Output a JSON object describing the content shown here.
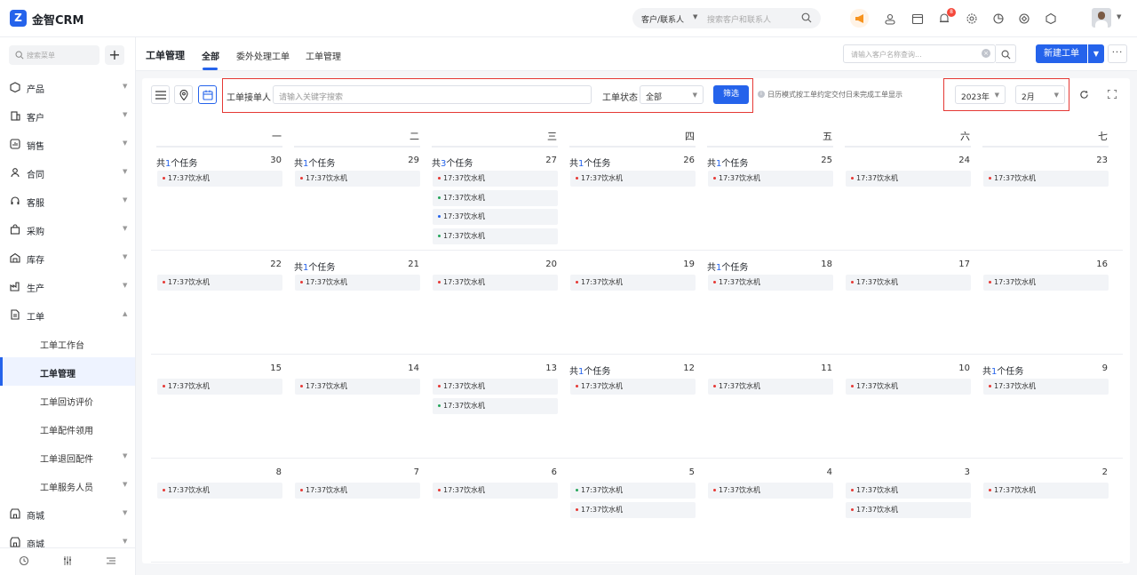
{
  "app": {
    "logo_letter": "Z",
    "brand": "金智CRM"
  },
  "topbar": {
    "search_type": "客户/联系人",
    "search_placeholder": "搜索客户和联系人",
    "notification_count": "8"
  },
  "sidebar": {
    "search_placeholder": "搜索菜单",
    "add_label": "+",
    "items": [
      {
        "label": "产品",
        "icon": "cube-icon"
      },
      {
        "label": "客户",
        "icon": "building-icon"
      },
      {
        "label": "销售",
        "icon": "chart-icon"
      },
      {
        "label": "合同",
        "icon": "person-icon"
      },
      {
        "label": "客服",
        "icon": "headset-icon"
      },
      {
        "label": "采购",
        "icon": "bag-icon"
      },
      {
        "label": "库存",
        "icon": "warehouse-icon"
      },
      {
        "label": "生产",
        "icon": "factory-icon"
      },
      {
        "label": "工单",
        "icon": "document-icon"
      }
    ],
    "sub_items": [
      {
        "label": "工单工作台"
      },
      {
        "label": "工单管理"
      },
      {
        "label": "工单回访评价"
      },
      {
        "label": "工单配件领用"
      },
      {
        "label": "工单退回配件"
      },
      {
        "label": "工单服务人员"
      }
    ],
    "bottom_items": [
      {
        "label": "商城",
        "icon": "store-icon"
      },
      {
        "label": "商城",
        "icon": "store-icon"
      }
    ]
  },
  "tabs": {
    "page_title": "工单管理",
    "items": [
      {
        "label": "全部"
      },
      {
        "label": "委外处理工单"
      },
      {
        "label": "工单管理"
      }
    ],
    "customer_search_placeholder": "请输入客户名称查询...",
    "new_button": "新建工单",
    "more_label": "···"
  },
  "filters": {
    "assignee_label": "工单接单人",
    "keyword_placeholder": "请输入关键字搜索",
    "status_label": "工单状态",
    "status_value": "全部",
    "filter_button": "筛选",
    "hint": "日历模式按工单约定交付日未完成工单显示",
    "year": "2023年",
    "month": "2月"
  },
  "calendar": {
    "weekdays": [
      "一",
      "二",
      "三",
      "四",
      "五",
      "六",
      "七"
    ],
    "weeks": [
      [
        {
          "day": "30",
          "count_prefix": "共",
          "count": "1",
          "count_suffix": "个任务",
          "tasks": [
            {
              "text": "17:37饮水机",
              "dot": "#e53935"
            }
          ]
        },
        {
          "day": "29",
          "count_prefix": "共",
          "count": "1",
          "count_suffix": "个任务",
          "tasks": [
            {
              "text": "17:37饮水机",
              "dot": "#e53935"
            }
          ]
        },
        {
          "day": "27",
          "count_prefix": "共",
          "count": "3",
          "count_suffix": "个任务",
          "tasks": [
            {
              "text": "17:37饮水机",
              "dot": "#e53935"
            },
            {
              "text": "17:37饮水机",
              "dot": "#26a65b"
            },
            {
              "text": "17:37饮水机",
              "dot": "#2563eb"
            },
            {
              "text": "17:37饮水机",
              "dot": "#26a65b"
            }
          ]
        },
        {
          "day": "26",
          "count_prefix": "共",
          "count": "1",
          "count_suffix": "个任务",
          "tasks": [
            {
              "text": "17:37饮水机",
              "dot": "#e53935"
            }
          ]
        },
        {
          "day": "25",
          "count_prefix": "共",
          "count": "1",
          "count_suffix": "个任务",
          "tasks": [
            {
              "text": "17:37饮水机",
              "dot": "#e53935"
            }
          ]
        },
        {
          "day": "24",
          "tasks": [
            {
              "text": "17:37饮水机",
              "dot": "#e53935"
            }
          ]
        },
        {
          "day": "23",
          "tasks": [
            {
              "text": "17:37饮水机",
              "dot": "#e53935"
            }
          ]
        }
      ],
      [
        {
          "day": "22",
          "tasks": [
            {
              "text": "17:37饮水机",
              "dot": "#e53935"
            }
          ]
        },
        {
          "day": "21",
          "count_prefix": "共",
          "count": "1",
          "count_suffix": "个任务",
          "tasks": [
            {
              "text": "17:37饮水机",
              "dot": "#e53935"
            }
          ]
        },
        {
          "day": "20",
          "tasks": [
            {
              "text": "17:37饮水机",
              "dot": "#e53935"
            }
          ]
        },
        {
          "day": "19",
          "tasks": [
            {
              "text": "17:37饮水机",
              "dot": "#e53935"
            }
          ]
        },
        {
          "day": "18",
          "count_prefix": "共",
          "count": "1",
          "count_suffix": "个任务",
          "tasks": [
            {
              "text": "17:37饮水机",
              "dot": "#e53935"
            }
          ]
        },
        {
          "day": "17",
          "tasks": [
            {
              "text": "17:37饮水机",
              "dot": "#e53935"
            }
          ]
        },
        {
          "day": "16",
          "tasks": [
            {
              "text": "17:37饮水机",
              "dot": "#e53935"
            }
          ]
        }
      ],
      [
        {
          "day": "15",
          "tasks": [
            {
              "text": "17:37饮水机",
              "dot": "#e53935"
            }
          ]
        },
        {
          "day": "14",
          "tasks": [
            {
              "text": "17:37饮水机",
              "dot": "#e53935"
            }
          ]
        },
        {
          "day": "13",
          "tasks": [
            {
              "text": "17:37饮水机",
              "dot": "#e53935"
            },
            {
              "text": "17:37饮水机",
              "dot": "#26a65b"
            }
          ]
        },
        {
          "day": "12",
          "count_prefix": "共",
          "count": "1",
          "count_suffix": "个任务",
          "tasks": [
            {
              "text": "17:37饮水机",
              "dot": "#e53935"
            }
          ]
        },
        {
          "day": "11",
          "tasks": [
            {
              "text": "17:37饮水机",
              "dot": "#e53935"
            }
          ]
        },
        {
          "day": "10",
          "tasks": [
            {
              "text": "17:37饮水机",
              "dot": "#e53935"
            }
          ]
        },
        {
          "day": "9",
          "count_prefix": "共",
          "count": "1",
          "count_suffix": "个任务",
          "tasks": [
            {
              "text": "17:37饮水机",
              "dot": "#e53935"
            }
          ]
        }
      ],
      [
        {
          "day": "8",
          "tasks": [
            {
              "text": "17:37饮水机",
              "dot": "#e53935"
            }
          ]
        },
        {
          "day": "7",
          "tasks": [
            {
              "text": "17:37饮水机",
              "dot": "#e53935"
            }
          ]
        },
        {
          "day": "6",
          "tasks": [
            {
              "text": "17:37饮水机",
              "dot": "#e53935"
            }
          ]
        },
        {
          "day": "5",
          "tasks": [
            {
              "text": "17:37饮水机",
              "dot": "#26a65b"
            },
            {
              "text": "17:37饮水机",
              "dot": "#e53935"
            }
          ]
        },
        {
          "day": "4",
          "tasks": [
            {
              "text": "17:37饮水机",
              "dot": "#e53935"
            }
          ]
        },
        {
          "day": "3",
          "tasks": [
            {
              "text": "17:37饮水机",
              "dot": "#e53935"
            },
            {
              "text": "17:37饮水机",
              "dot": "#e53935"
            }
          ]
        },
        {
          "day": "2",
          "tasks": [
            {
              "text": "17:37饮水机",
              "dot": "#e53935"
            }
          ]
        }
      ]
    ]
  },
  "colors": {
    "accent": "#2563eb",
    "highlight_box": "#e53935",
    "badge": "#f5483b"
  }
}
